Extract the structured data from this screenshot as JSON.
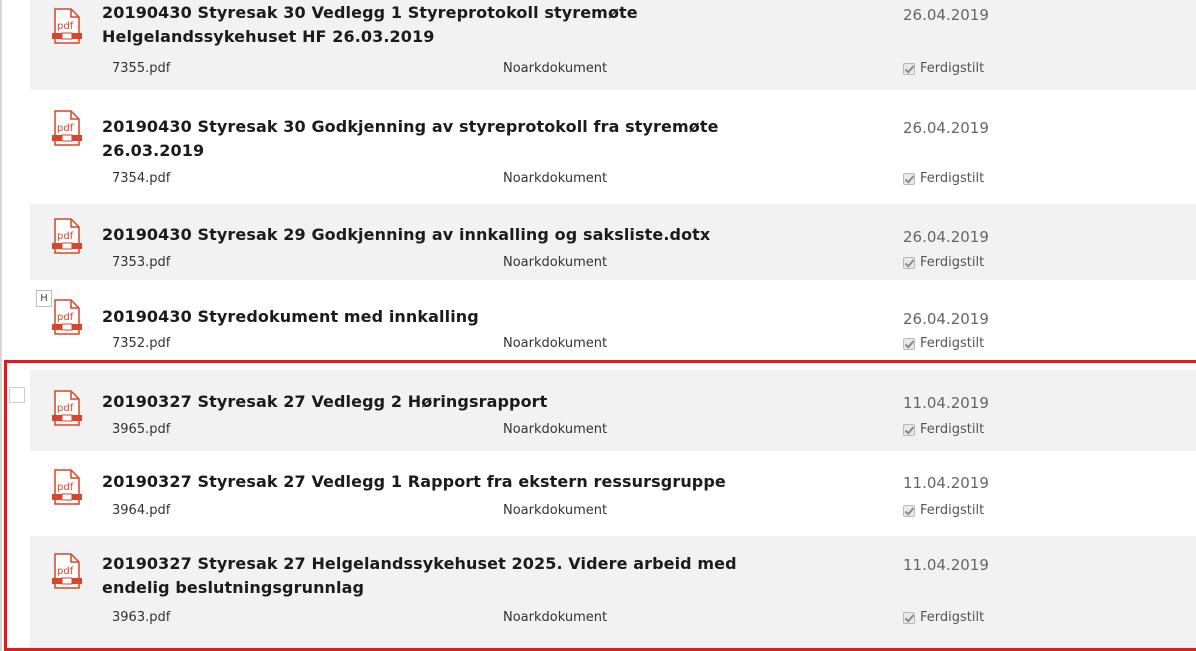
{
  "documents": [
    {
      "title": "20190430 Styresak 30 Vedlegg 1 Styreprotokoll styremøte Helgelandssykehuset HF 26.03.2019",
      "filename": "7355.pdf",
      "doctype": "Noarkdokument",
      "date": "26.04.2019",
      "status": "Ferdigstilt"
    },
    {
      "title": "20190430 Styresak 30 Godkjenning av styreprotokoll fra styremøte 26.03.2019",
      "filename": "7354.pdf",
      "doctype": "Noarkdokument",
      "date": "26.04.2019",
      "status": "Ferdigstilt"
    },
    {
      "title": "20190430 Styresak 29 Godkjenning av innkalling og saksliste.dotx",
      "filename": "7353.pdf",
      "doctype": "Noarkdokument",
      "date": "26.04.2019",
      "status": "Ferdigstilt"
    },
    {
      "title": "20190430 Styredokument med innkalling",
      "filename": "7352.pdf",
      "doctype": "Noarkdokument",
      "date": "26.04.2019",
      "status": "Ferdigstilt",
      "badge": "H"
    },
    {
      "title": "20190327 Styresak 27 Vedlegg 2 Høringsrapport",
      "filename": "3965.pdf",
      "doctype": "Noarkdokument",
      "date": "11.04.2019",
      "status": "Ferdigstilt"
    },
    {
      "title": "20190327 Styresak 27 Vedlegg 1 Rapport fra ekstern ressursgruppe",
      "filename": "3964.pdf",
      "doctype": "Noarkdokument",
      "date": "11.04.2019",
      "status": "Ferdigstilt"
    },
    {
      "title": "20190327 Styresak 27 Helgelandssykehuset 2025. Videre arbeid med endelig beslutningsgrunnlag",
      "filename": "3963.pdf",
      "doctype": "Noarkdokument",
      "date": "11.04.2019",
      "status": "Ferdigstilt"
    }
  ],
  "icon_label": "pdf",
  "colors": {
    "highlight_border": "#e3191e",
    "pdf_icon": "#d9442c",
    "row_shaded": "#f2f2f2"
  }
}
